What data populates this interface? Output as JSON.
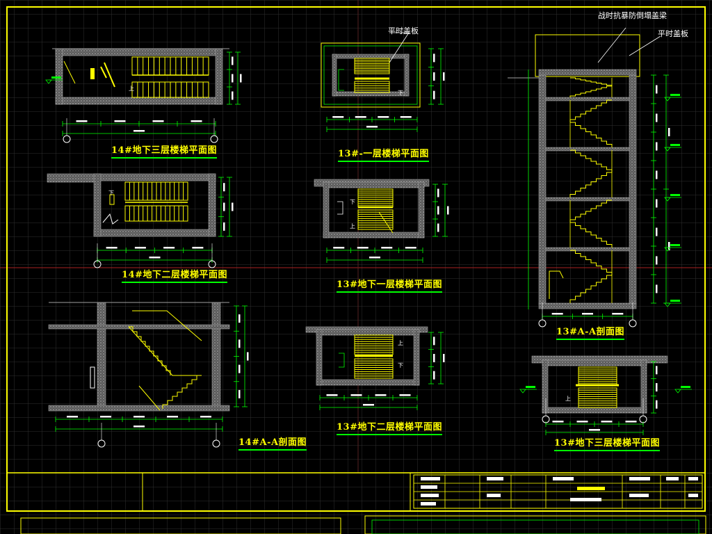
{
  "sheet": {
    "colors": {
      "background": "#000000",
      "frame": "#ffff00",
      "grid": "#303030",
      "wall": "#a0a0a0",
      "stair": "#ffff00",
      "dimension": "#00ff00",
      "axis": "#aa2222",
      "text": "#ffffff"
    },
    "drawings": [
      {
        "id": "d1",
        "title": "14#地下三层楼梯平面图",
        "kind": "plan"
      },
      {
        "id": "d2",
        "title": "14#地下二层楼梯平面图",
        "kind": "plan"
      },
      {
        "id": "d3",
        "title": "14#A-A剖面图",
        "kind": "section"
      },
      {
        "id": "d4",
        "title": "13#-一层楼梯平面图",
        "kind": "plan"
      },
      {
        "id": "d5",
        "title": "13#地下一层楼梯平面图",
        "kind": "plan"
      },
      {
        "id": "d6",
        "title": "13#地下二层楼梯平面图",
        "kind": "plan"
      },
      {
        "id": "d7",
        "title": "13#A-A剖面图",
        "kind": "section"
      },
      {
        "id": "d8",
        "title": "13#地下三层楼梯平面图",
        "kind": "plan"
      }
    ],
    "annotations": {
      "temp_cover_1": "平时盖板",
      "temp_cover_2": "平时盖板",
      "wartime_wall": "战时抗暴防倒塌盖梁",
      "stair_up": "上",
      "stair_down": "下"
    }
  }
}
